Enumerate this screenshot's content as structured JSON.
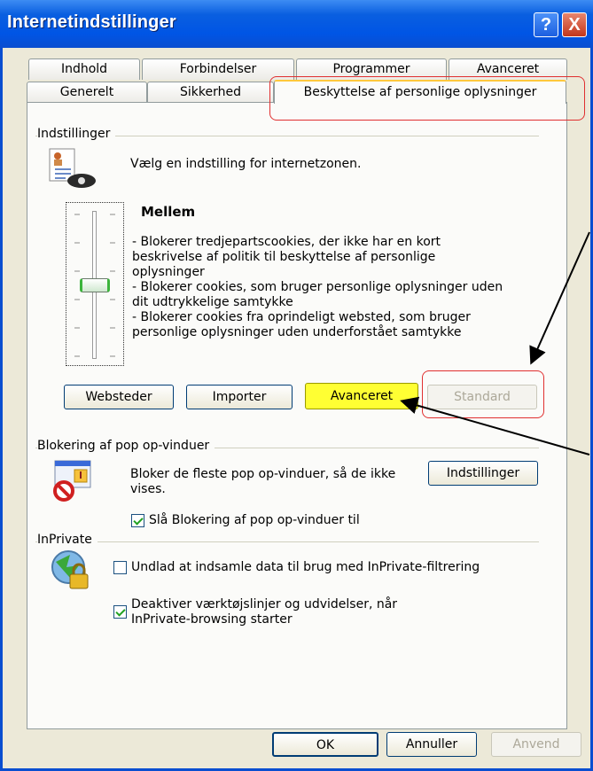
{
  "window": {
    "title": "Internetindstillinger",
    "help_label": "?",
    "close_label": "X"
  },
  "tabs": {
    "row1": [
      "Indhold",
      "Forbindelser",
      "Programmer",
      "Avanceret"
    ],
    "row2": [
      "Generelt",
      "Sikkerhed"
    ],
    "active": "Beskyttelse af personlige oplysninger"
  },
  "settings": {
    "group_title": "Indstillinger",
    "intro": "Vælg en indstilling for internetzonen.",
    "level_title": "Mellem",
    "level_description_lines": [
      "- Blokerer tredjepartscookies, der ikke har en kort",
      "beskrivelse af politik til beskyttelse af personlige",
      "oplysninger",
      "- Blokerer cookies, som bruger personlige oplysninger uden",
      "dit udtrykkelige samtykke",
      "- Blokerer cookies fra oprindeligt websted, som bruger",
      "personlige oplysninger uden underforstået samtykke"
    ],
    "slider_level_fraction": 0.5,
    "buttons": {
      "websteder": "Websteder",
      "importer": "Importer",
      "avanceret": "Avanceret",
      "standard": "Standard"
    }
  },
  "popup": {
    "group_title": "Blokering af pop op-vinduer",
    "description_lines": [
      "Bloker de fleste pop op-vinduer, så de ikke",
      "vises."
    ],
    "settings_button": "Indstillinger",
    "checkbox_label": "Slå Blokering af pop op-vinduer til",
    "checkbox_checked": true
  },
  "inprivate": {
    "group_title": "InPrivate",
    "option1_label": "Undlad at indsamle data til brug med InPrivate-filtrering",
    "option1_checked": false,
    "option2_lines": [
      "Deaktiver værktøjslinjer og udvidelser, når",
      "InPrivate-browsing starter"
    ],
    "option2_checked": true
  },
  "footer": {
    "ok": "OK",
    "cancel": "Annuller",
    "apply": "Anvend"
  },
  "colors": {
    "highlight": "#ffff00",
    "annotation": "#e03030",
    "title_bar": "#0055e5"
  }
}
